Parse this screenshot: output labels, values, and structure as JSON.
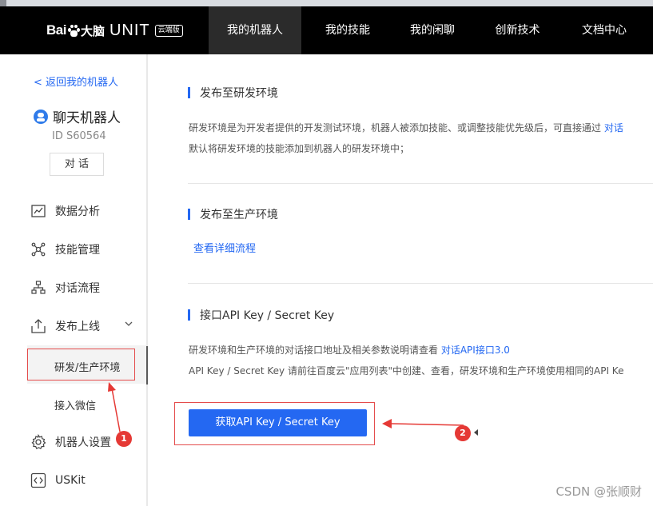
{
  "header": {
    "logo_bai": "Bai",
    "logo_brand": "大脑",
    "logo_unit": "UNIT",
    "logo_badge": "云端版",
    "nav": [
      {
        "label": "我的机器人",
        "active": true
      },
      {
        "label": "我的技能",
        "active": false
      },
      {
        "label": "我的闲聊",
        "active": false
      },
      {
        "label": "创新技术",
        "active": false
      },
      {
        "label": "文档中心",
        "active": false
      }
    ]
  },
  "sidebar": {
    "back_label": "< 返回我的机器人",
    "robot_name": "聊天机器人",
    "robot_id": "ID S60564",
    "chat_button": "对 话",
    "menu": [
      {
        "label": "数据分析",
        "icon": "chart-icon"
      },
      {
        "label": "技能管理",
        "icon": "skill-network-icon"
      },
      {
        "label": "对话流程",
        "icon": "flow-tree-icon"
      },
      {
        "label": "发布上线",
        "icon": "upload-icon"
      },
      {
        "label": "机器人设置",
        "icon": "gear-icon"
      },
      {
        "label": "USKit",
        "icon": "code-icon"
      }
    ],
    "submenu": [
      {
        "label": "研发/生产环境",
        "active": true
      },
      {
        "label": "接入微信",
        "active": false
      }
    ]
  },
  "main": {
    "section1": {
      "title": "发布至研发环境",
      "line1": "研发环境是为开发者提供的开发测试环境，机器人被添加技能、或调整技能优先级后，可直接通过",
      "line1_link": "对话",
      "line2": "默认将研发环境的技能添加到机器人的研发环境中；"
    },
    "section2": {
      "title": "发布至生产环境",
      "link": "查看详细流程"
    },
    "section3": {
      "title": "接口API Key / Secret Key",
      "line1": "研发环境和生产环境的对话接口地址及相关参数说明请查看",
      "line1_link": "对话API接口3.0",
      "line2": "API Key / Secret Key 请前往百度云\"应用列表\"中创建、查看，研发环境和生产环境使用相同的API Ke",
      "button": "获取API Key / Secret Key"
    }
  },
  "annotations": {
    "marker1": "1",
    "marker2": "2",
    "color": "#e53935"
  },
  "watermark": "CSDN @张顺财"
}
